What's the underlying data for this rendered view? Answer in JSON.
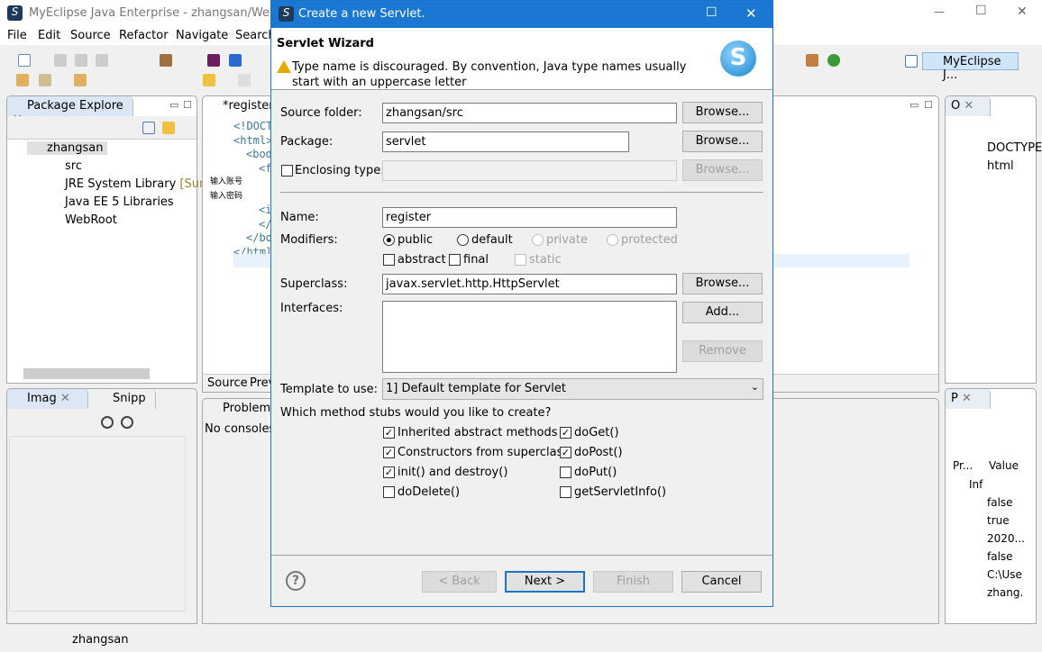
{
  "window": {
    "title": "MyEclipse Java Enterprise - zhangsan/WebRoo",
    "controls": {
      "minimize": "—",
      "maximize": "☐",
      "close": "✕"
    }
  },
  "menu": [
    "File",
    "Edit",
    "Source",
    "Refactor",
    "Navigate",
    "Search"
  ],
  "perspective": {
    "label": "MyEclipse J..."
  },
  "package_explorer": {
    "tab": "Package Explore",
    "tree": [
      {
        "label": "zhangsan"
      },
      {
        "label": "src"
      },
      {
        "label": "JRE System Library",
        "suffix": "[Sun J"
      },
      {
        "label": "Java EE 5 Libraries"
      },
      {
        "label": "WebRoot"
      }
    ]
  },
  "editor": {
    "tab": "*register.",
    "lines": [
      "<!DOCT",
      "<html>",
      "<bod",
      "<f",
      "输入账号",
      "输入密码",
      "<i",
      "</",
      "</bo",
      "</html"
    ],
    "bottom_tabs": [
      "Source",
      "Prev"
    ]
  },
  "outline": {
    "tab": "O",
    "items": [
      "DOCTYPE:",
      "html"
    ]
  },
  "image_panel": {
    "tabs": [
      "Imag",
      "Snipp"
    ]
  },
  "console": {
    "tab": "Problems",
    "message": "No consoles"
  },
  "properties": {
    "tab": "P",
    "headers": [
      "Pr...",
      "Value"
    ],
    "group": "Inf",
    "values": [
      "false",
      "true",
      "2020...",
      "false",
      "C:\\Use",
      "zhang."
    ]
  },
  "status": {
    "text": "zhangsan"
  },
  "dialog": {
    "title": "Create a new Servlet.",
    "header": "Servlet Wizard",
    "warning": "Type name is discouraged. By convention, Java type names usually start with an uppercase letter",
    "source_folder": {
      "label": "Source folder:",
      "value": "zhangsan/src",
      "browse": "Browse..."
    },
    "package": {
      "label": "Package:",
      "value": "servlet",
      "browse": "Browse..."
    },
    "enclosing": {
      "label": "Enclosing type:",
      "value": "",
      "browse": "Browse...",
      "checked": false
    },
    "name": {
      "label": "Name:",
      "value": "register"
    },
    "modifiers": {
      "label": "Modifiers:",
      "options": [
        "public",
        "default",
        "private",
        "protected"
      ],
      "selected": "public",
      "extra": [
        "abstract",
        "final",
        "static"
      ]
    },
    "superclass": {
      "label": "Superclass:",
      "value": "javax.servlet.http.HttpServlet",
      "browse": "Browse..."
    },
    "interfaces": {
      "label": "Interfaces:",
      "add": "Add...",
      "remove": "Remove"
    },
    "template": {
      "label": "Template to use:",
      "value": "1] Default template for Servlet"
    },
    "stubs_question": "Which method stubs would you like to create?",
    "stubs": [
      {
        "label": "Inherited abstract methods",
        "checked": true
      },
      {
        "label": "doGet()",
        "checked": true
      },
      {
        "label": "Constructors from superclass",
        "checked": true
      },
      {
        "label": "doPost()",
        "checked": true
      },
      {
        "label": "init() and destroy()",
        "checked": true
      },
      {
        "label": "doPut()",
        "checked": false
      },
      {
        "label": "doDelete()",
        "checked": false
      },
      {
        "label": "getServletInfo()",
        "checked": false
      }
    ],
    "buttons": {
      "help": "?",
      "back": "< Back",
      "next": "Next >",
      "finish": "Finish",
      "cancel": "Cancel"
    }
  }
}
